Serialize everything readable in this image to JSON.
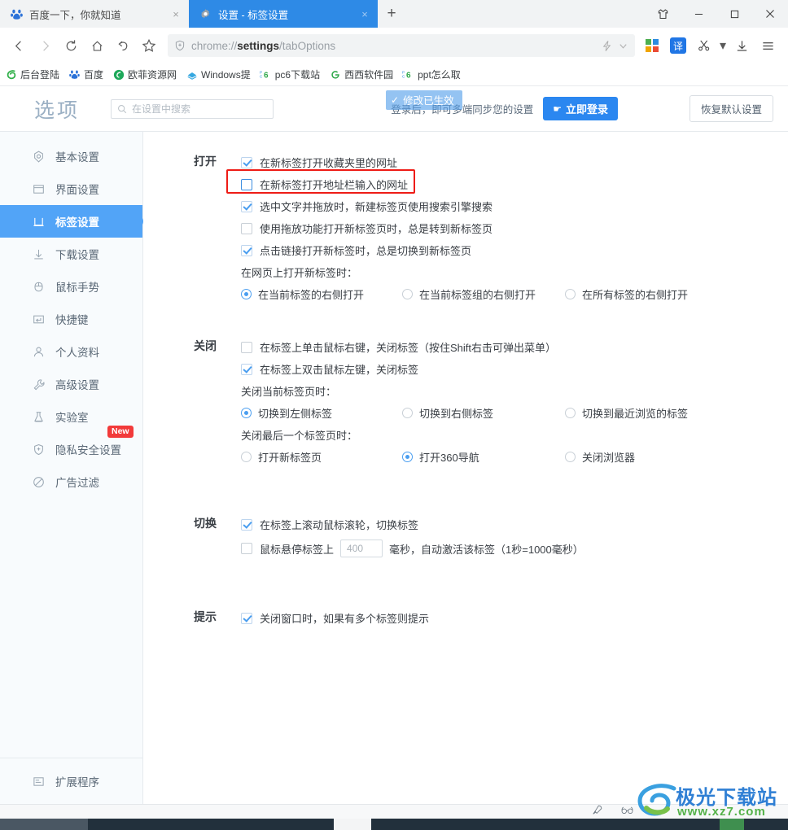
{
  "browser": {
    "tabs": [
      {
        "title": "百度一下，你就知道",
        "icon": "baidu-favicon",
        "active": false,
        "close_label": "×"
      },
      {
        "title": "设置 - 标签设置",
        "icon": "gear-favicon",
        "active": true,
        "close_label": "×"
      }
    ],
    "new_tab_label": "+",
    "window_controls": {
      "skin": "shirt-icon",
      "minimize": "−",
      "maximize": "□",
      "close": "✕"
    },
    "nav": {
      "back": "back-icon",
      "forward": "forward-icon",
      "reload": "reload-icon",
      "home": "home-icon",
      "undo": "undo-icon",
      "bookmark": "star-icon"
    },
    "omnibox": {
      "shield_icon": "shield-plus-icon",
      "url_prefix": "chrome://",
      "url_bold": "settings",
      "url_suffix": "/tabOptions",
      "speed_icon": "lightning-icon",
      "chevron_icon": "chevron-down-icon"
    },
    "toolbar_right": {
      "metro_icon": "metro-grid-icon",
      "translate_label": "译",
      "scissors_icon": "scissors-icon",
      "scissors_caret": "▾",
      "download_icon": "download-icon",
      "menu_icon": "hamburger-menu-icon"
    },
    "bookmarks": [
      {
        "label": "后台登陆",
        "icon": "swirl-green-icon"
      },
      {
        "label": "百度",
        "icon": "baidu-paw-icon"
      },
      {
        "label": "欧菲资源网",
        "icon": "green-circle-icon"
      },
      {
        "label": "Windows提",
        "icon": "windows-blue-icon"
      },
      {
        "label": "pc6下载站",
        "icon": "pc6-icon"
      },
      {
        "label": "西西软件园",
        "icon": "g-plus-icon"
      },
      {
        "label": "ppt怎么取",
        "icon": "pc6-icon"
      }
    ]
  },
  "settings": {
    "logo": "选项",
    "search": {
      "placeholder": "在设置中搜索",
      "value": "",
      "icon": "search-icon"
    },
    "toast": {
      "text": "修改已生效",
      "icon": "check-icon"
    },
    "login_hint": "登录后，即可多端同步您的设置",
    "login_button": "立即登录",
    "login_button_icon": "pointing-hand-icon",
    "reset_button": "恢复默认设置",
    "accent_color": "#52a4f7",
    "highlight_color": "#ee1c16"
  },
  "sidebar": {
    "items": [
      {
        "label": "基本设置",
        "icon": "circle-target-icon",
        "active": false,
        "badge": ""
      },
      {
        "label": "界面设置",
        "icon": "window-icon",
        "active": false,
        "badge": ""
      },
      {
        "label": "标签设置",
        "icon": "tab-icon",
        "active": true,
        "badge": ""
      },
      {
        "label": "下载设置",
        "icon": "download-arrow-icon",
        "active": false,
        "badge": ""
      },
      {
        "label": "鼠标手势",
        "icon": "mouse-icon",
        "active": false,
        "badge": ""
      },
      {
        "label": "快捷键",
        "icon": "keyboard-key-icon",
        "active": false,
        "badge": ""
      },
      {
        "label": "个人资料",
        "icon": "person-icon",
        "active": false,
        "badge": ""
      },
      {
        "label": "高级设置",
        "icon": "wrench-icon",
        "active": false,
        "badge": ""
      },
      {
        "label": "实验室",
        "icon": "flask-icon",
        "active": false,
        "badge": ""
      },
      {
        "label": "隐私安全设置",
        "icon": "shield-plus-icon",
        "active": false,
        "badge": "New"
      },
      {
        "label": "广告过滤",
        "icon": "no-entry-icon",
        "active": false,
        "badge": ""
      }
    ],
    "footer": {
      "label": "扩展程序",
      "icon": "extension-icon"
    }
  },
  "sections": [
    {
      "title": "打开",
      "checkboxes": [
        {
          "label": "在新标签打开收藏夹里的网址",
          "checked": true,
          "highlighted": false
        },
        {
          "label": "在新标签打开地址栏输入的网址",
          "checked": false,
          "highlighted": true
        },
        {
          "label": "选中文字并拖放时，新建标签页使用搜索引擎搜索",
          "checked": true,
          "highlighted": false
        },
        {
          "label": "使用拖放功能打开新标签页时，总是转到新标签页",
          "checked": false,
          "highlighted": false
        },
        {
          "label": "点击链接打开新标签时，总是切换到新标签页",
          "checked": true,
          "highlighted": false
        }
      ],
      "radio_groups": [
        {
          "label": "在网页上打开新标签时：",
          "options": [
            {
              "label": "在当前标签的右侧打开",
              "selected": true
            },
            {
              "label": "在当前标签组的右侧打开",
              "selected": false
            },
            {
              "label": "在所有标签的右侧打开",
              "selected": false
            }
          ]
        }
      ]
    },
    {
      "title": "关闭",
      "checkboxes": [
        {
          "label": "在标签上单击鼠标右键，关闭标签（按住Shift右击可弹出菜单）",
          "checked": false,
          "highlighted": false
        },
        {
          "label": "在标签上双击鼠标左键，关闭标签",
          "checked": true,
          "highlighted": false
        }
      ],
      "radio_groups": [
        {
          "label": "关闭当前标签页时：",
          "options": [
            {
              "label": "切换到左侧标签",
              "selected": true
            },
            {
              "label": "切换到右侧标签",
              "selected": false
            },
            {
              "label": "切换到最近浏览的标签",
              "selected": false
            }
          ]
        },
        {
          "label": "关闭最后一个标签页时：",
          "options": [
            {
              "label": "打开新标签页",
              "selected": false
            },
            {
              "label": "打开360导航",
              "selected": true
            },
            {
              "label": "关闭浏览器",
              "selected": false
            }
          ]
        }
      ]
    },
    {
      "title": "切换",
      "checkboxes": [
        {
          "label": "在标签上滚动鼠标滚轮，切换标签",
          "checked": true,
          "highlighted": false
        }
      ],
      "hover_row": {
        "checked": false,
        "prefix": "鼠标悬停标签上",
        "input_value": "400",
        "suffix": "毫秒，自动激活该标签（1秒=1000毫秒）"
      }
    },
    {
      "title": "提示",
      "checkboxes": [
        {
          "label": "关闭窗口时，如果有多个标签则提示",
          "checked": true,
          "highlighted": false
        }
      ]
    }
  ],
  "watermark": {
    "title": "极光下载站",
    "url": "www.xz7.com"
  }
}
